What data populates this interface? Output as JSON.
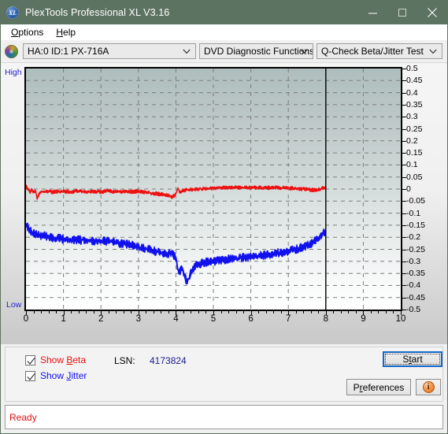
{
  "window": {
    "title": "PlexTools Professional XL V3.16",
    "icon": "XL",
    "icon_name": "plextools-logo-icon",
    "buttons": {
      "minimize": "minimize-icon",
      "maximize": "maximize-icon",
      "close": "close-icon"
    },
    "titlebar_color": "#5d7361"
  },
  "menubar": {
    "items": [
      {
        "label": "Options",
        "mnemonic": "O"
      },
      {
        "label": "Help",
        "mnemonic": "H"
      }
    ]
  },
  "toolbar": {
    "disc_icon": "disc-drive-icon",
    "drive_select": {
      "value": "HA:0 ID:1  PX-716A",
      "options": [
        "HA:0 ID:1  PX-716A"
      ]
    },
    "function_select": {
      "value": "DVD Diagnostic Functions",
      "options": [
        "DVD Diagnostic Functions"
      ]
    },
    "test_select": {
      "value": "Q-Check Beta/Jitter Test",
      "options": [
        "Q-Check Beta/Jitter Test"
      ]
    }
  },
  "chart_axes": {
    "high_label": "High",
    "low_label": "Low"
  },
  "controls": {
    "show_beta": {
      "label_prefix": "Show ",
      "label_mnemonic": "B",
      "label_suffix": "eta",
      "checked": true,
      "color": "#ee1111"
    },
    "show_jitter": {
      "label_prefix": "Show ",
      "label_mnemonic": "J",
      "label_suffix": "itter",
      "checked": true,
      "color": "#1111ee"
    },
    "lsn_label": "LSN:",
    "lsn_value": "4173824",
    "start_button": {
      "prefix": "S",
      "mnemonic": "t",
      "suffix": "art",
      "full": "Start"
    },
    "preferences_button": {
      "prefix": "P",
      "mnemonic": "r",
      "suffix": "eferences",
      "full": "Preferences"
    },
    "info_button": {
      "glyph": "i",
      "name": "info-icon"
    }
  },
  "statusbar": {
    "text": "Ready",
    "color": "#dd1111"
  },
  "chart_data": {
    "type": "line",
    "title": "Q-Check Beta/Jitter Test",
    "xlabel": "",
    "ylabel": "",
    "xlim": [
      0,
      10
    ],
    "ylim": [
      -0.5,
      0.5
    ],
    "grid": true,
    "legend_position": "below-left",
    "x_ticks": [
      0,
      1,
      2,
      3,
      4,
      5,
      6,
      7,
      8,
      9,
      10
    ],
    "y_ticks": [
      0.5,
      0.45,
      0.4,
      0.35,
      0.3,
      0.25,
      0.2,
      0.15,
      0.1,
      0.05,
      0,
      -0.05,
      -0.1,
      -0.15,
      -0.2,
      -0.25,
      -0.3,
      -0.35,
      -0.4,
      -0.45,
      -0.5
    ],
    "y_tick_labels": [
      "0.5",
      "0.45",
      "0.4",
      "0.35",
      "0.3",
      "0.25",
      "0.2",
      "0.15",
      "0.1",
      "0.05",
      "0",
      "-0.05",
      "-0.1",
      "-0.15",
      "-0.2",
      "-0.25",
      "-0.3",
      "-0.35",
      "-0.4",
      "-0.45",
      "-0.5"
    ],
    "data_end_marker_x": 8,
    "plot_bg_top": "#aebebd",
    "plot_bg_bottom": "#ffffff",
    "series": [
      {
        "name": "Beta",
        "color": "#ee1111",
        "x": [
          0.0,
          0.05,
          0.1,
          0.15,
          0.2,
          0.25,
          0.3,
          0.35,
          0.4,
          0.5,
          0.6,
          0.7,
          0.8,
          0.9,
          1.0,
          1.2,
          1.4,
          1.6,
          1.8,
          2.0,
          2.2,
          2.4,
          2.6,
          2.8,
          3.0,
          3.2,
          3.4,
          3.6,
          3.8,
          3.9,
          4.0,
          4.05,
          4.1,
          4.2,
          4.3,
          4.4,
          4.6,
          4.8,
          5.0,
          5.2,
          5.4,
          5.6,
          5.8,
          6.0,
          6.2,
          6.4,
          6.6,
          6.8,
          7.0,
          7.2,
          7.4,
          7.6,
          7.8,
          7.95,
          8.0
        ],
        "y": [
          0.01,
          0.0,
          -0.012,
          -0.004,
          -0.014,
          -0.006,
          -0.04,
          -0.018,
          -0.01,
          -0.012,
          -0.008,
          -0.014,
          -0.01,
          -0.012,
          -0.01,
          -0.012,
          -0.008,
          -0.012,
          -0.01,
          -0.012,
          -0.008,
          -0.012,
          -0.01,
          -0.012,
          -0.01,
          -0.014,
          -0.018,
          -0.022,
          -0.026,
          -0.034,
          -0.022,
          0.006,
          -0.012,
          -0.006,
          -0.004,
          -0.002,
          0.0,
          0.002,
          0.004,
          0.004,
          0.006,
          0.006,
          0.006,
          0.006,
          0.006,
          0.006,
          0.006,
          0.006,
          0.004,
          0.002,
          0.0,
          -0.004,
          -0.002,
          0.004,
          0.006
        ],
        "noise_amplitude": 0.01
      },
      {
        "name": "Jitter",
        "color": "#1111ee",
        "x": [
          0.0,
          0.05,
          0.1,
          0.15,
          0.2,
          0.3,
          0.4,
          0.5,
          0.6,
          0.7,
          0.8,
          0.9,
          1.0,
          1.2,
          1.4,
          1.6,
          1.8,
          2.0,
          2.2,
          2.4,
          2.6,
          2.8,
          3.0,
          3.2,
          3.4,
          3.6,
          3.8,
          3.9,
          4.0,
          4.05,
          4.1,
          4.15,
          4.2,
          4.25,
          4.3,
          4.35,
          4.4,
          4.5,
          4.6,
          4.8,
          5.0,
          5.2,
          5.4,
          5.6,
          5.8,
          6.0,
          6.2,
          6.4,
          6.6,
          6.8,
          7.0,
          7.2,
          7.4,
          7.6,
          7.8,
          7.9,
          8.0
        ],
        "y": [
          -0.145,
          -0.16,
          -0.17,
          -0.18,
          -0.185,
          -0.19,
          -0.192,
          -0.195,
          -0.198,
          -0.2,
          -0.205,
          -0.206,
          -0.207,
          -0.21,
          -0.212,
          -0.212,
          -0.214,
          -0.216,
          -0.218,
          -0.222,
          -0.226,
          -0.232,
          -0.24,
          -0.248,
          -0.256,
          -0.264,
          -0.272,
          -0.258,
          -0.29,
          -0.33,
          -0.352,
          -0.318,
          -0.346,
          -0.374,
          -0.38,
          -0.372,
          -0.34,
          -0.32,
          -0.312,
          -0.304,
          -0.3,
          -0.296,
          -0.292,
          -0.288,
          -0.284,
          -0.282,
          -0.278,
          -0.274,
          -0.268,
          -0.262,
          -0.258,
          -0.25,
          -0.24,
          -0.226,
          -0.206,
          -0.186,
          -0.17
        ],
        "noise_amplitude": 0.022
      }
    ]
  }
}
